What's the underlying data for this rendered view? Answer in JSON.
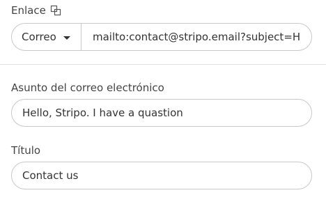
{
  "link": {
    "label": "Enlace",
    "icon": "link-copy-icon",
    "type_select": "Correo",
    "url_value": "mailto:contact@stripo.email?subject=H"
  },
  "subject": {
    "label": "Asunto del correo electrónico",
    "value": "Hello, Stripo. I have a quastion"
  },
  "title": {
    "label": "Título",
    "value": "Contact us"
  }
}
